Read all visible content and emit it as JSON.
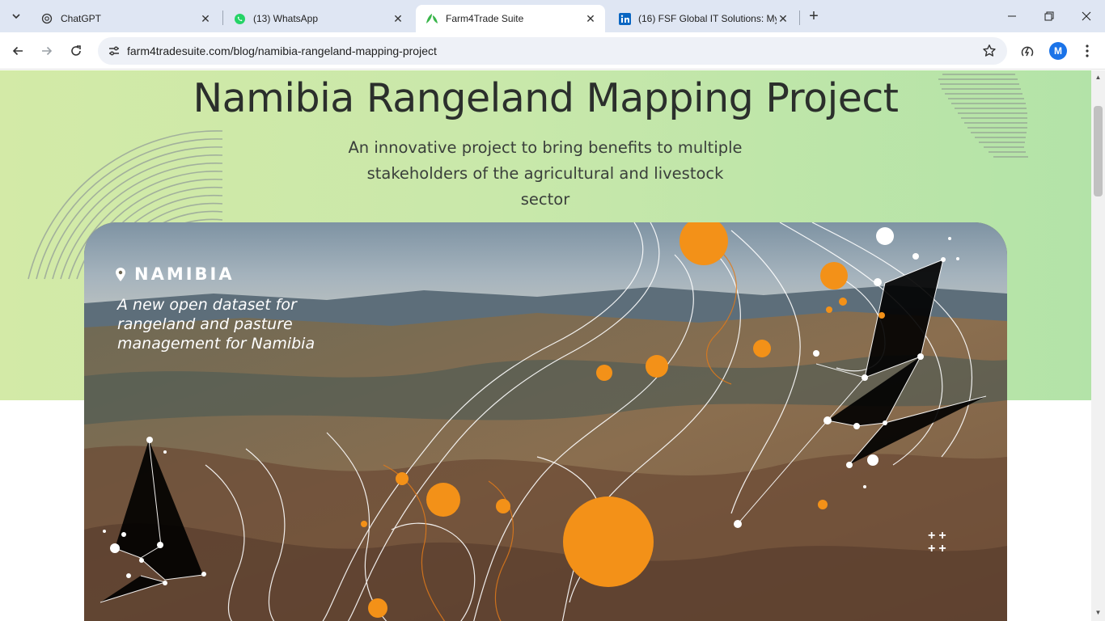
{
  "browser": {
    "tabs": [
      {
        "title": "ChatGPT",
        "icon": "chatgpt-icon",
        "active": false
      },
      {
        "title": "(13) WhatsApp",
        "icon": "whatsapp-icon",
        "active": false
      },
      {
        "title": "Farm4Trade Suite",
        "icon": "leaf-icon",
        "active": true
      },
      {
        "title": "(16) FSF Global IT Solutions: My",
        "icon": "linkedin-icon",
        "active": false
      }
    ],
    "close_glyph": "✕",
    "new_tab_glyph": "+",
    "url": "farm4tradesuite.com/blog/namibia-rangeland-mapping-project",
    "profile_initial": "M"
  },
  "page": {
    "title": "Namibia Rangeland Mapping Project",
    "subtitle": "An innovative project to bring benefits to multiple stakeholders of the agricultural and livestock sector",
    "banner": {
      "place": "NAMIBIA",
      "tagline": "A new open dataset for rangeland and pasture management for Namibia",
      "plus_marks": "++ ++"
    }
  },
  "colors": {
    "hero_start": "#d3eaa7",
    "hero_end": "#b3e3a8",
    "accent_orange": "#f39118",
    "title_text": "#2b2f2c",
    "chrome_tabstrip": "#dfe6f3",
    "profile_blue": "#1a73e8"
  }
}
